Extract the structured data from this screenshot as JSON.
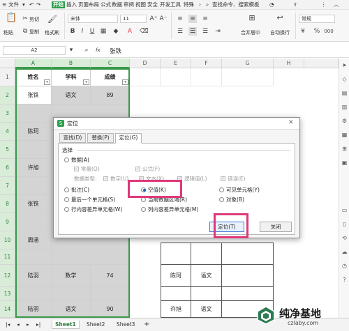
{
  "menu": {
    "file": "文件",
    "items": [
      "开始",
      "插入",
      "页面布局",
      "公式",
      "数据",
      "审阅",
      "视图",
      "安全",
      "开发工具",
      "特殊"
    ],
    "active_index": 0,
    "search": "查找命令、搜索模板"
  },
  "ribbon": {
    "paste": "粘贴",
    "cut": "剪切",
    "copy": "复制",
    "format_painter": "格式刷",
    "font_name": "宋体",
    "font_size": "11",
    "bold": "B",
    "italic": "I",
    "underline": "U",
    "merge": "合并居中",
    "wrap": "自动换行",
    "number_format": "常规",
    "percent": "%",
    "thousands": "000"
  },
  "formula_bar": {
    "name_box": "A2",
    "fx": "fx",
    "content": "张铁"
  },
  "grid": {
    "columns": [
      "A",
      "B",
      "C",
      "D",
      "E",
      "F",
      "G",
      "H"
    ],
    "rows": [
      "1",
      "2",
      "3",
      "4",
      "5",
      "6",
      "7",
      "8",
      "9",
      "10",
      "11",
      "12",
      "13",
      "14"
    ],
    "headers": [
      "姓名",
      "学科",
      "成绩"
    ],
    "cells": {
      "r2": [
        "张铁",
        "语文",
        "89"
      ],
      "r4": [
        "陈珂",
        "",
        ""
      ],
      "r6": [
        "许旭",
        "",
        ""
      ],
      "r8": [
        "张铁",
        "",
        ""
      ],
      "r10": [
        "周涵",
        "",
        ""
      ],
      "r12": [
        "陆羽",
        "数学",
        "74"
      ],
      "r14": [
        "陆羽",
        "语文",
        "90"
      ]
    },
    "side_table": {
      "r12": [
        "陈珂",
        "语文"
      ],
      "r14": [
        "许旭",
        "语文"
      ]
    }
  },
  "dialog": {
    "title": "定位",
    "tabs": [
      "查找(D)",
      "替换(P)",
      "定位(G)"
    ],
    "active_tab": 2,
    "section": "选择",
    "data": "数据(A)",
    "constant": "常量(O)",
    "formula": "公式(F)",
    "data_type": "数据类型:",
    "number": "数字(U)",
    "text": "文本(X)",
    "logical": "逻辑值(L)",
    "error": "错误(E)",
    "comment": "批注(C)",
    "blank": "空值(K)",
    "visible": "可见单元格(Y)",
    "last_cell": "最后一个单元格(S)",
    "current_array": "当前数据区域(R)",
    "object": "对象(B)",
    "row_diff": "行内容差异单元格(W)",
    "col_diff": "列内容差异单元格(M)",
    "locate_button": "定位(T)",
    "close_button": "关闭"
  },
  "sheets": {
    "tabs": [
      "Sheet1",
      "Sheet2",
      "Sheet3"
    ],
    "active": 0,
    "add": "+"
  },
  "watermark": {
    "brand": "纯净基地",
    "url": "czlaby.com"
  },
  "colors": {
    "accent": "#2f9f4f",
    "highlight_box": "#e0387a",
    "primary_blue": "#1e5fc2",
    "empty_fill": "#d4d4d4"
  }
}
